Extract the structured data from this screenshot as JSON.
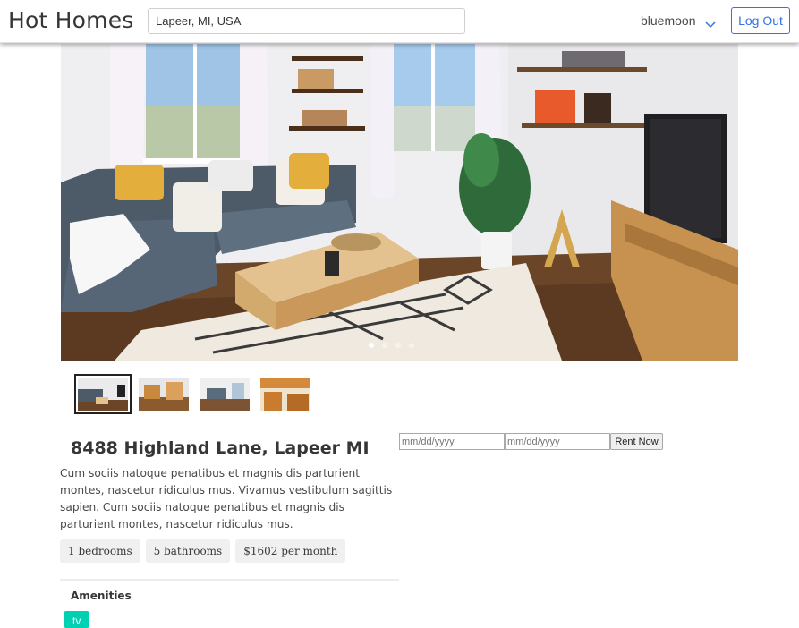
{
  "navbar": {
    "brand": "Hot Homes",
    "search_value": "Lapeer, MI, USA",
    "username": "bluemoon",
    "logout_label": "Log Out"
  },
  "gallery": {
    "slide_count": 4,
    "active_slide": 1,
    "thumbnail_count": 4
  },
  "listing": {
    "title": "8488 Highland Lane, Lapeer MI",
    "description": "Cum sociis natoque penatibus et magnis dis parturient montes, nascetur ridiculus mus. Vivamus vestibulum sagittis sapien. Cum sociis natoque penatibus et magnis dis parturient montes, nascetur ridiculus mus.",
    "tags": [
      "1 bedrooms",
      "5 bathrooms",
      "$1602 per month"
    ]
  },
  "amenities": {
    "heading": "Amenities",
    "items": [
      "tv"
    ]
  },
  "booking": {
    "start_placeholder": "mm/dd/yyyy",
    "end_placeholder": "mm/dd/yyyy",
    "rent_label": "Rent Now"
  },
  "colors": {
    "primary": "#3273dc",
    "amenity": "#00d1b2",
    "tag_bg": "#f0f0f0"
  }
}
